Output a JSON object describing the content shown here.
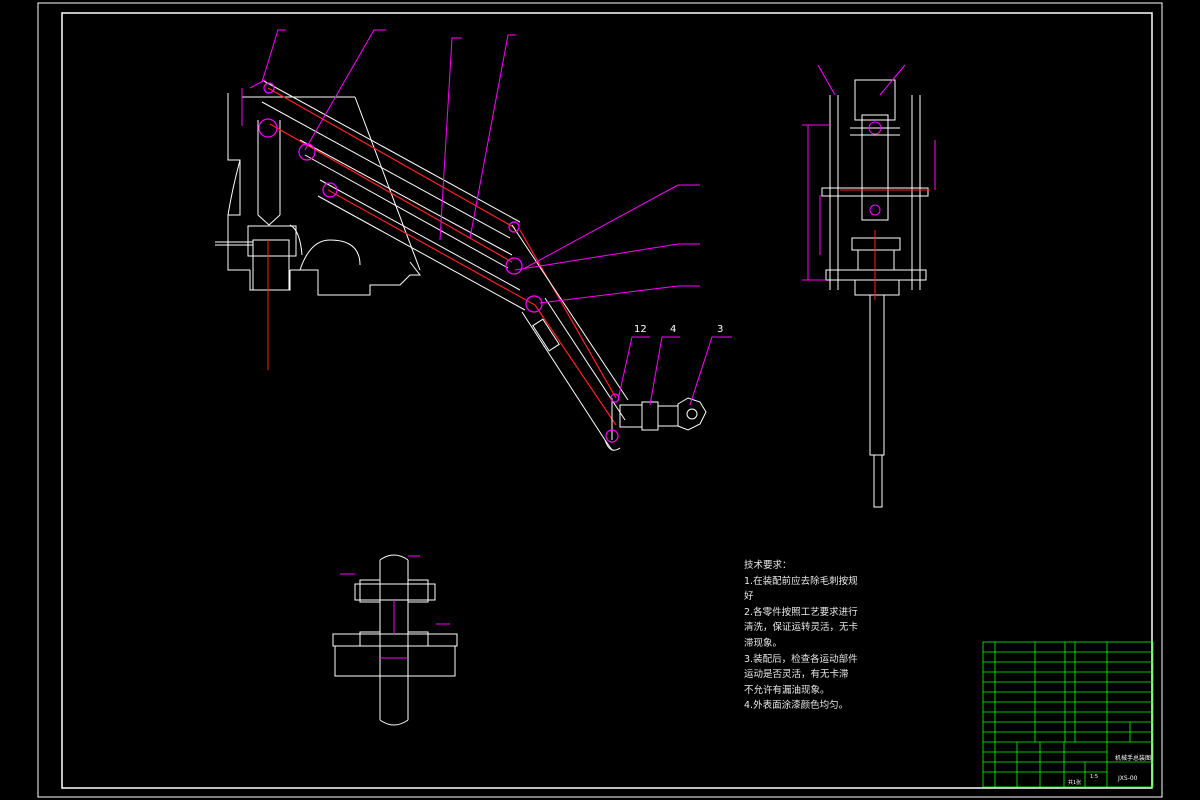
{
  "drawing": {
    "callouts": {
      "c12": "12",
      "c4": "4",
      "c3": "3"
    },
    "tech_requirements": {
      "title": "技术要求：",
      "lines": [
        "1.在装配前应去除毛刺按规",
        "好",
        "2.各零件按照工艺要求进行",
        "清洗，保证运转灵活，无卡",
        "滞现象。",
        "3.装配后，检查各运动部件",
        "运动是否灵活，有无卡滞",
        "不允许有漏油现象。",
        "4.外表面涂漆颜色均匀。"
      ]
    },
    "title_block": {
      "drawing_title": "机械手总装图",
      "drawing_number": "JXS-00",
      "scale": "1:5",
      "sheet": "共1张"
    }
  },
  "colors": {
    "background": "#000000",
    "outline": "#ffffff",
    "magenta": "#ff00ff",
    "red": "#ff2020",
    "table_green": "#00ff00"
  }
}
